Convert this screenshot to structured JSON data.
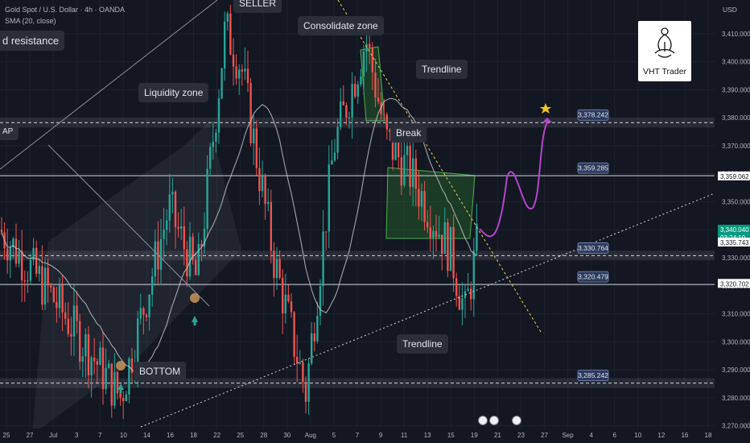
{
  "header": {
    "symbol_line": "Gold Spot / U.S. Dollar · 4h · OANDA",
    "indicator_line": "SMA (20, close)"
  },
  "price_axis": {
    "currency": "USD",
    "ticks": [
      "3,410.000",
      "3,400.000",
      "3,390.000",
      "3,380.000",
      "3,370.000",
      "3,360.000",
      "3,350.000",
      "3,340.000",
      "3,330.000",
      "3,320.000",
      "3,310.000",
      "3,300.000",
      "3,290.000",
      "3,280.000",
      "3,270.000"
    ]
  },
  "time_axis": {
    "ticks": [
      "25",
      "27",
      "Jul",
      "3",
      "7",
      "10",
      "14",
      "16",
      "18",
      "22",
      "25",
      "28",
      "30",
      "Aug",
      "5",
      "7",
      "9",
      "11",
      "13",
      "15",
      "19",
      "21",
      "23",
      "27",
      "Sep",
      "4",
      "6",
      "10",
      "12",
      "16",
      "18"
    ]
  },
  "price_tags": [
    {
      "text": "3,359.062",
      "kind": "line"
    },
    {
      "text": "3,340.040",
      "kind": "current"
    },
    {
      "text": "03:24:19",
      "kind": "countdown"
    },
    {
      "text": "3,335.743",
      "kind": "line"
    },
    {
      "text": "3,320.702",
      "kind": "line"
    }
  ],
  "level_labels": [
    "3,378.242",
    "3,359.285",
    "3,330.764",
    "3,320.479",
    "3,285.242"
  ],
  "annotations": {
    "seller": "SELLER",
    "resistance": "d resistance",
    "consolidate": "Consolidate zone",
    "trendline_top": "Trendline",
    "liquidity": "Liquidity zone",
    "break": "Break",
    "trendline_bottom": "Trendline",
    "bottom": "BOTTOM",
    "gap_left": "AP"
  },
  "logo": {
    "text": "VHT Trader"
  },
  "colors": {
    "background": "#131722",
    "bull": "#26a69a",
    "bear": "#ef5350",
    "projection": "#b845c9",
    "trendline_top": "#e6d23c",
    "zone_fill": "#2e7d32",
    "level_label": "#2c3a5c",
    "current_price": "#089981"
  },
  "chart_data": {
    "type": "candlestick",
    "instrument": "XAUUSD",
    "timeframe": "4h",
    "ylim": [
      3265,
      3418
    ],
    "horizontal_levels": [
      3378.242,
      3359.285,
      3330.764,
      3320.479,
      3285.242
    ],
    "current_price": 3340.04
  }
}
